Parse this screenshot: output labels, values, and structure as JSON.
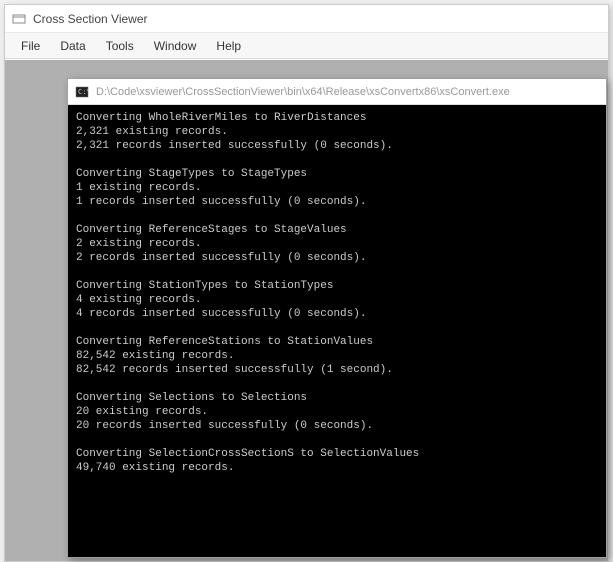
{
  "app": {
    "title": "Cross Section Viewer"
  },
  "menu": {
    "items": [
      "File",
      "Data",
      "Tools",
      "Window",
      "Help"
    ]
  },
  "console": {
    "title": "D:\\Code\\xsviewer\\CrossSectionViewer\\bin\\x64\\Release\\xsConvertx86\\xsConvert.exe",
    "blocks": [
      {
        "lines": [
          "Converting WholeRiverMiles to RiverDistances",
          "2,321 existing records.",
          "2,321 records inserted successfully (0 seconds)."
        ]
      },
      {
        "lines": [
          "Converting StageTypes to StageTypes",
          "1 existing records.",
          "1 records inserted successfully (0 seconds)."
        ]
      },
      {
        "lines": [
          "Converting ReferenceStages to StageValues",
          "2 existing records.",
          "2 records inserted successfully (0 seconds)."
        ]
      },
      {
        "lines": [
          "Converting StationTypes to StationTypes",
          "4 existing records.",
          "4 records inserted successfully (0 seconds)."
        ]
      },
      {
        "lines": [
          "Converting ReferenceStations to StationValues",
          "82,542 existing records.",
          "82,542 records inserted successfully (1 second)."
        ]
      },
      {
        "lines": [
          "Converting Selections to Selections",
          "20 existing records.",
          "20 records inserted successfully (0 seconds)."
        ]
      },
      {
        "lines": [
          "Converting SelectionCrossSectionS to SelectionValues",
          "49,740 existing records."
        ]
      }
    ]
  }
}
